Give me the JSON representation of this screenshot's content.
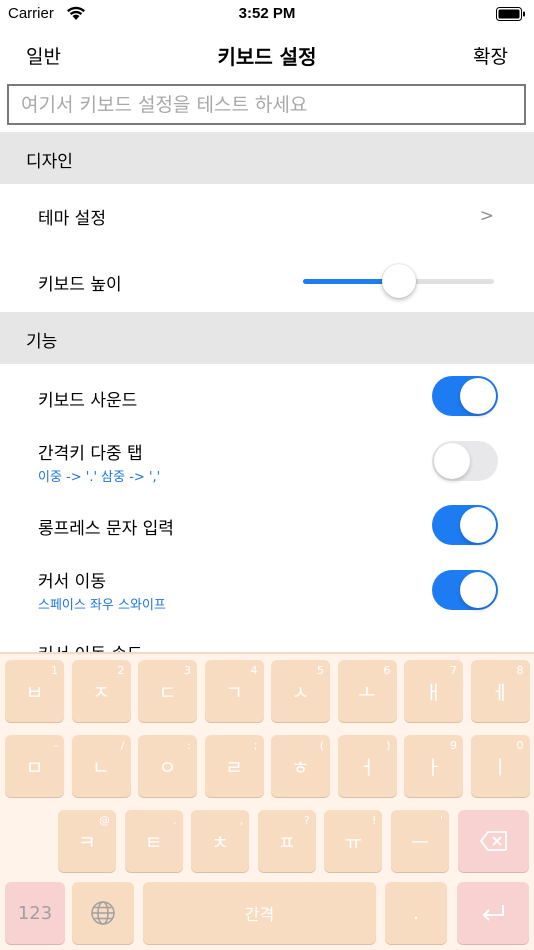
{
  "status_bar": {
    "carrier": "Carrier",
    "time": "3:52 PM"
  },
  "nav": {
    "left": "일반",
    "title": "키보드 설정",
    "right": "확장"
  },
  "test_input": {
    "placeholder": "여기서 키보드 설정을 테스트 하세요",
    "value": ""
  },
  "sections": {
    "design": {
      "title": "디자인",
      "theme_label": "테마 설정",
      "theme_chevron": ">",
      "height_label": "키보드 높이",
      "height_slider_value": 0.5
    },
    "function": {
      "title": "기능",
      "rows": [
        {
          "label": "키보드 사운드",
          "sub": "",
          "on": true
        },
        {
          "label": "간격키 다중 탭",
          "sub": "이중 -> '.' 삼중 -> ','",
          "on": false
        },
        {
          "label": "롱프레스 문자 입력",
          "sub": "",
          "on": true
        },
        {
          "label": "커서 이동",
          "sub": "스페이스 좌우 스와이프",
          "on": true
        }
      ],
      "partial_row_label": "커서 이동 속도"
    }
  },
  "keyboard": {
    "row1": [
      {
        "glyph": "ㅂ",
        "hint": "1"
      },
      {
        "glyph": "ㅈ",
        "hint": "2"
      },
      {
        "glyph": "ㄷ",
        "hint": "3"
      },
      {
        "glyph": "ㄱ",
        "hint": "4"
      },
      {
        "glyph": "ㅅ",
        "hint": "5"
      },
      {
        "glyph": "ㅗ",
        "hint": "6"
      },
      {
        "glyph": "ㅐ",
        "hint": "7"
      },
      {
        "glyph": "ㅔ",
        "hint": "8"
      }
    ],
    "row2": [
      {
        "glyph": "ㅁ",
        "hint": "-"
      },
      {
        "glyph": "ㄴ",
        "hint": "/"
      },
      {
        "glyph": "ㅇ",
        "hint": ":"
      },
      {
        "glyph": "ㄹ",
        "hint": ";"
      },
      {
        "glyph": "ㅎ",
        "hint": "("
      },
      {
        "glyph": "ㅓ",
        "hint": ")"
      },
      {
        "glyph": "ㅏ",
        "hint": "9"
      },
      {
        "glyph": "ㅣ",
        "hint": "0"
      }
    ],
    "row3": [
      {
        "glyph": "ㅋ",
        "hint": "@"
      },
      {
        "glyph": "ㅌ",
        "hint": "."
      },
      {
        "glyph": "ㅊ",
        "hint": ","
      },
      {
        "glyph": "ㅍ",
        "hint": "?"
      },
      {
        "glyph": "ㅠ",
        "hint": "!"
      },
      {
        "glyph": "ㅡ",
        "hint": "'"
      }
    ],
    "numbers_label": "123",
    "space_label": "간격",
    "period_label": "."
  }
}
